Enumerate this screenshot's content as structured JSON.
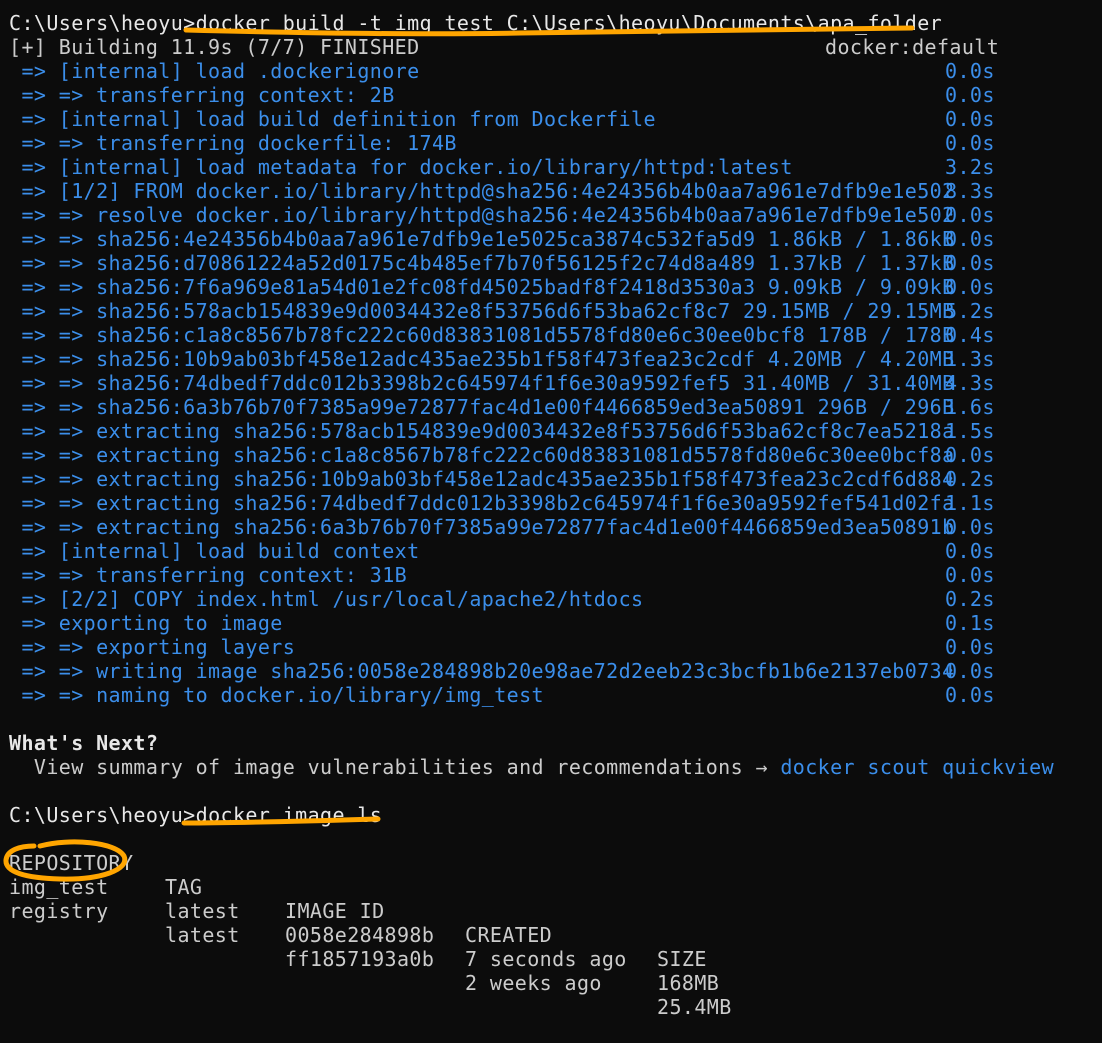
{
  "prompt1": "C:\\Users\\heoyu>",
  "command1": "docker build -t img_test C:\\Users\\heoyu\\Documents\\apa_folder",
  "build_status": "[+] Building 11.9s (7/7) FINISHED",
  "builder": "docker:default",
  "steps": [
    {
      "text": " => [internal] load .dockerignore",
      "time": "0.0s"
    },
    {
      "text": " => => transferring context: 2B",
      "time": "0.0s"
    },
    {
      "text": " => [internal] load build definition from Dockerfile",
      "time": "0.0s"
    },
    {
      "text": " => => transferring dockerfile: 174B",
      "time": "0.0s"
    },
    {
      "text": " => [internal] load metadata for docker.io/library/httpd:latest",
      "time": "3.2s"
    },
    {
      "text": " => [1/2] FROM docker.io/library/httpd@sha256:4e24356b4b0aa7a961e7dfb9e1e502",
      "time": "8.3s"
    },
    {
      "text": " => => resolve docker.io/library/httpd@sha256:4e24356b4b0aa7a961e7dfb9e1e502",
      "time": "0.0s"
    },
    {
      "text": " => => sha256:4e24356b4b0aa7a961e7dfb9e1e5025ca3874c532fa5d9 1.86kB / 1.86kB",
      "time": "0.0s"
    },
    {
      "text": " => => sha256:d70861224a52d0175c4b485ef7b70f56125f2c74d8a489 1.37kB / 1.37kB",
      "time": "0.0s"
    },
    {
      "text": " => => sha256:7f6a969e81a54d01e2fc08fd45025badf8f2418d3530a3 9.09kB / 9.09kB",
      "time": "0.0s"
    },
    {
      "text": " => => sha256:578acb154839e9d0034432e8f53756d6f53ba62cf8c7 29.15MB / 29.15MB",
      "time": "5.2s"
    },
    {
      "text": " => => sha256:c1a8c8567b78fc222c60d83831081d5578fd80e6c30ee0bcf8 178B / 178B",
      "time": "0.4s"
    },
    {
      "text": " => => sha256:10b9ab03bf458e12adc435ae235b1f58f473fea23c2cdf 4.20MB / 4.20MB",
      "time": "1.3s"
    },
    {
      "text": " => => sha256:74dbedf7ddc012b3398b2c645974f1f6e30a9592fef5 31.40MB / 31.40MB",
      "time": "4.3s"
    },
    {
      "text": " => => sha256:6a3b76b70f7385a99e72877fac4d1e00f4466859ed3ea50891 296B / 296B",
      "time": "1.6s"
    },
    {
      "text": " => => extracting sha256:578acb154839e9d0034432e8f53756d6f53ba62cf8c7ea5218a",
      "time": "1.5s"
    },
    {
      "text": " => => extracting sha256:c1a8c8567b78fc222c60d83831081d5578fd80e6c30ee0bcf8a",
      "time": "0.0s"
    },
    {
      "text": " => => extracting sha256:10b9ab03bf458e12adc435ae235b1f58f473fea23c2cdf6d884",
      "time": "0.2s"
    },
    {
      "text": " => => extracting sha256:74dbedf7ddc012b3398b2c645974f1f6e30a9592fef541d02fa",
      "time": "1.1s"
    },
    {
      "text": " => => extracting sha256:6a3b76b70f7385a99e72877fac4d1e00f4466859ed3ea50891b",
      "time": "0.0s"
    },
    {
      "text": " => [internal] load build context",
      "time": "0.0s"
    },
    {
      "text": " => => transferring context: 31B",
      "time": "0.0s"
    },
    {
      "text": " => [2/2] COPY index.html /usr/local/apache2/htdocs",
      "time": "0.2s"
    },
    {
      "text": " => exporting to image",
      "time": "0.1s"
    },
    {
      "text": " => => exporting layers",
      "time": "0.0s"
    },
    {
      "text": " => => writing image sha256:0058e284898b20e98ae72d2eeb23c3bcfb1b6e2137eb0734",
      "time": "0.0s"
    },
    {
      "text": " => => naming to docker.io/library/img_test",
      "time": "0.0s"
    }
  ],
  "whats_next_title": "What's Next?",
  "whats_next_text": "  View summary of image vulnerabilities and recommendations → ",
  "whats_next_link": "docker scout quickview",
  "prompt2": "C:\\Users\\heoyu>",
  "command2": "docker image ls",
  "table": {
    "headers": [
      "REPOSITORY",
      "TAG",
      "IMAGE ID",
      "CREATED",
      "SIZE"
    ],
    "rows": [
      [
        "img_test",
        "latest",
        "0058e284898b",
        "7 seconds ago",
        "168MB"
      ],
      [
        "registry",
        "latest",
        "ff1857193a0b",
        "2 weeks ago",
        "25.4MB"
      ]
    ]
  },
  "colors": {
    "background": "#0c0c0c",
    "text": "#cccccc",
    "accent_blue": "#3b8eea",
    "annotation_orange": "#ffa500"
  }
}
